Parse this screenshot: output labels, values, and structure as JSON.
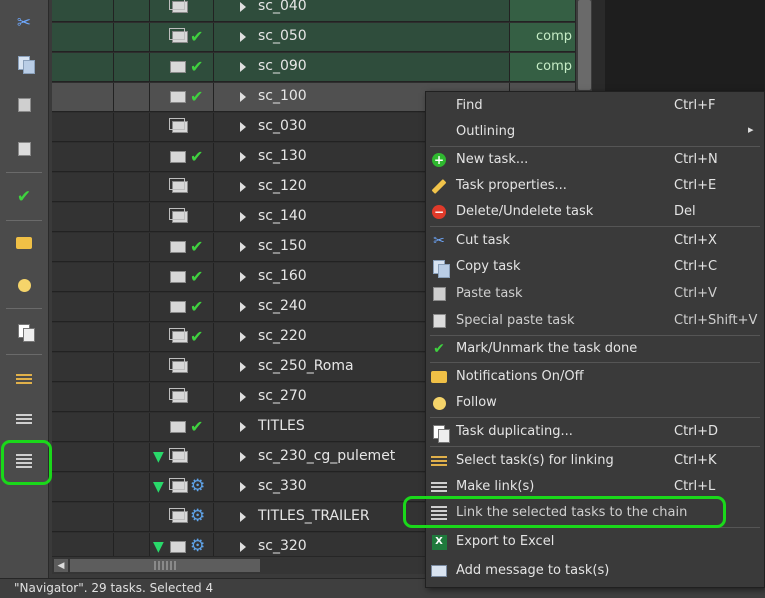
{
  "grid": {
    "rows": [
      {
        "name": "sc_040",
        "status": "",
        "style": "green",
        "done": false,
        "icon": "stack"
      },
      {
        "name": "sc_050",
        "status": "comp",
        "style": "green",
        "done": true,
        "icon": "stack"
      },
      {
        "name": "sc_090",
        "status": "comp",
        "style": "green",
        "done": true,
        "icon": "single"
      },
      {
        "name": "sc_100",
        "status": "",
        "style": "sel",
        "done": true,
        "icon": "single"
      },
      {
        "name": "sc_030",
        "status": "",
        "style": "dark",
        "done": false,
        "icon": "stack"
      },
      {
        "name": "sc_130",
        "status": "",
        "style": "dark",
        "done": true,
        "icon": "single"
      },
      {
        "name": "sc_120",
        "status": "",
        "style": "dark",
        "done": false,
        "icon": "stack"
      },
      {
        "name": "sc_140",
        "status": "",
        "style": "dark",
        "done": false,
        "icon": "stack"
      },
      {
        "name": "sc_150",
        "status": "",
        "style": "dark",
        "done": true,
        "icon": "single"
      },
      {
        "name": "sc_160",
        "status": "",
        "style": "dark",
        "done": true,
        "icon": "single"
      },
      {
        "name": "sc_240",
        "status": "",
        "style": "dark",
        "done": true,
        "icon": "single"
      },
      {
        "name": "sc_220",
        "status": "",
        "style": "dark",
        "done": true,
        "icon": "stack"
      },
      {
        "name": "sc_250_Roma",
        "status": "",
        "style": "dark",
        "done": false,
        "icon": "stack"
      },
      {
        "name": "sc_270",
        "status": "",
        "style": "dark",
        "done": false,
        "icon": "stack"
      },
      {
        "name": "TITLES",
        "status": "",
        "style": "dark",
        "done": true,
        "icon": "single"
      },
      {
        "name": "sc_230_cg_pulemet",
        "status": "",
        "style": "dark",
        "done": false,
        "icon": "stack"
      },
      {
        "name": "sc_330",
        "status": "",
        "style": "dark",
        "done": false,
        "icon": "stack"
      },
      {
        "name": "TITLES_TRAILER",
        "status": "",
        "style": "dark",
        "done": false,
        "icon": "stack"
      },
      {
        "name": "sc_320",
        "status": "",
        "style": "dark",
        "done": false,
        "icon": "single"
      }
    ]
  },
  "statusbar": {
    "text": "\"Navigator\". 29 tasks. Selected 4"
  },
  "toolbar": {
    "icons": [
      "cut-icon",
      "copy-icon",
      "paste-icon",
      "special-paste-icon",
      "mark-done-icon",
      "notifications-icon",
      "follow-icon",
      "duplicate-icon",
      "select-for-linking-icon",
      "make-link-icon",
      "link-chain-icon"
    ]
  },
  "menu": {
    "items": [
      {
        "label": "Find",
        "shortcut": "Ctrl+F"
      },
      {
        "label": "Outlining",
        "shortcut": ""
      },
      {
        "label": "New task...",
        "shortcut": "Ctrl+N"
      },
      {
        "label": "Task properties...",
        "shortcut": "Ctrl+E"
      },
      {
        "label": "Delete/Undelete task",
        "shortcut": "Del"
      },
      {
        "label": "Cut task",
        "shortcut": "Ctrl+X"
      },
      {
        "label": "Copy task",
        "shortcut": "Ctrl+C"
      },
      {
        "label": "Paste task",
        "shortcut": "Ctrl+V"
      },
      {
        "label": "Special paste task",
        "shortcut": "Ctrl+Shift+V"
      },
      {
        "label": "Mark/Unmark the task done",
        "shortcut": ""
      },
      {
        "label": "Notifications On/Off",
        "shortcut": ""
      },
      {
        "label": "Follow",
        "shortcut": ""
      },
      {
        "label": "Task duplicating...",
        "shortcut": "Ctrl+D"
      },
      {
        "label": "Select task(s) for linking",
        "shortcut": "Ctrl+K"
      },
      {
        "label": "Make link(s)",
        "shortcut": "Ctrl+L"
      },
      {
        "label": "Link the selected tasks to the chain",
        "shortcut": ""
      },
      {
        "label": "Export to Excel",
        "shortcut": ""
      },
      {
        "label": "Add message to task(s)",
        "shortcut": ""
      }
    ]
  },
  "colors": {
    "highlight": "#1ad81a",
    "done_check": "#3fd13f",
    "completed_row": "#2f4d3c"
  }
}
